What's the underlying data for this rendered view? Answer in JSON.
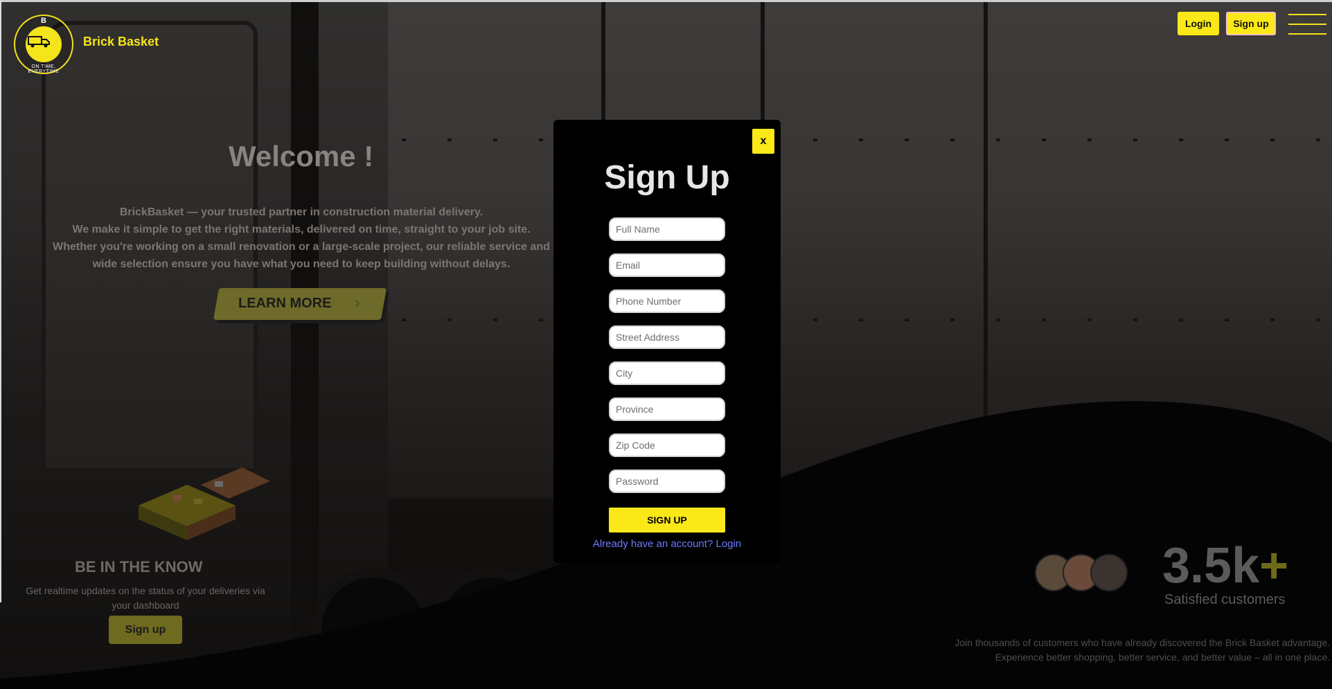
{
  "header": {
    "brand": "Brick Basket",
    "logo_letter": "B",
    "logo_tagline": "ON TIME, EVERYTIME",
    "login_label": "Login",
    "signup_label": "Sign up"
  },
  "hero": {
    "title": "Welcome !",
    "lines": [
      "BrickBasket — your trusted partner in construction material delivery.",
      "We make it simple to get the right materials, delivered on time, straight to your job site.",
      "Whether you're working on a small renovation or a large-scale project, our reliable service and",
      "wide selection ensure you have what you need to keep building without delays."
    ],
    "learn_more_label": "LEARN MORE"
  },
  "know": {
    "title": "BE IN THE KNOW",
    "text": "Get realtime updates on the status of your deliveries via your dashboard",
    "button_label": "Sign up"
  },
  "stats": {
    "number": "3.5k",
    "plus": "+",
    "label": "Satisfied customers",
    "join_lines": [
      "Join thousands of customers who have already discovered the Brick Basket advantage.",
      "Experience better shopping, better service, and better value – all in one place."
    ]
  },
  "modal": {
    "close_label": "x",
    "title": "Sign Up",
    "fields": {
      "full_name": "Full Name",
      "email": "Email",
      "phone": "Phone Number",
      "street": "Street Address",
      "city": "City",
      "province": "Province",
      "zip": "Zip Code",
      "password": "Password"
    },
    "submit_label": "SIGN UP",
    "login_link": "Already have an account? Login"
  },
  "colors": {
    "accent": "#fbe818",
    "modal_bg": "#000000",
    "link": "#6b7bff"
  }
}
